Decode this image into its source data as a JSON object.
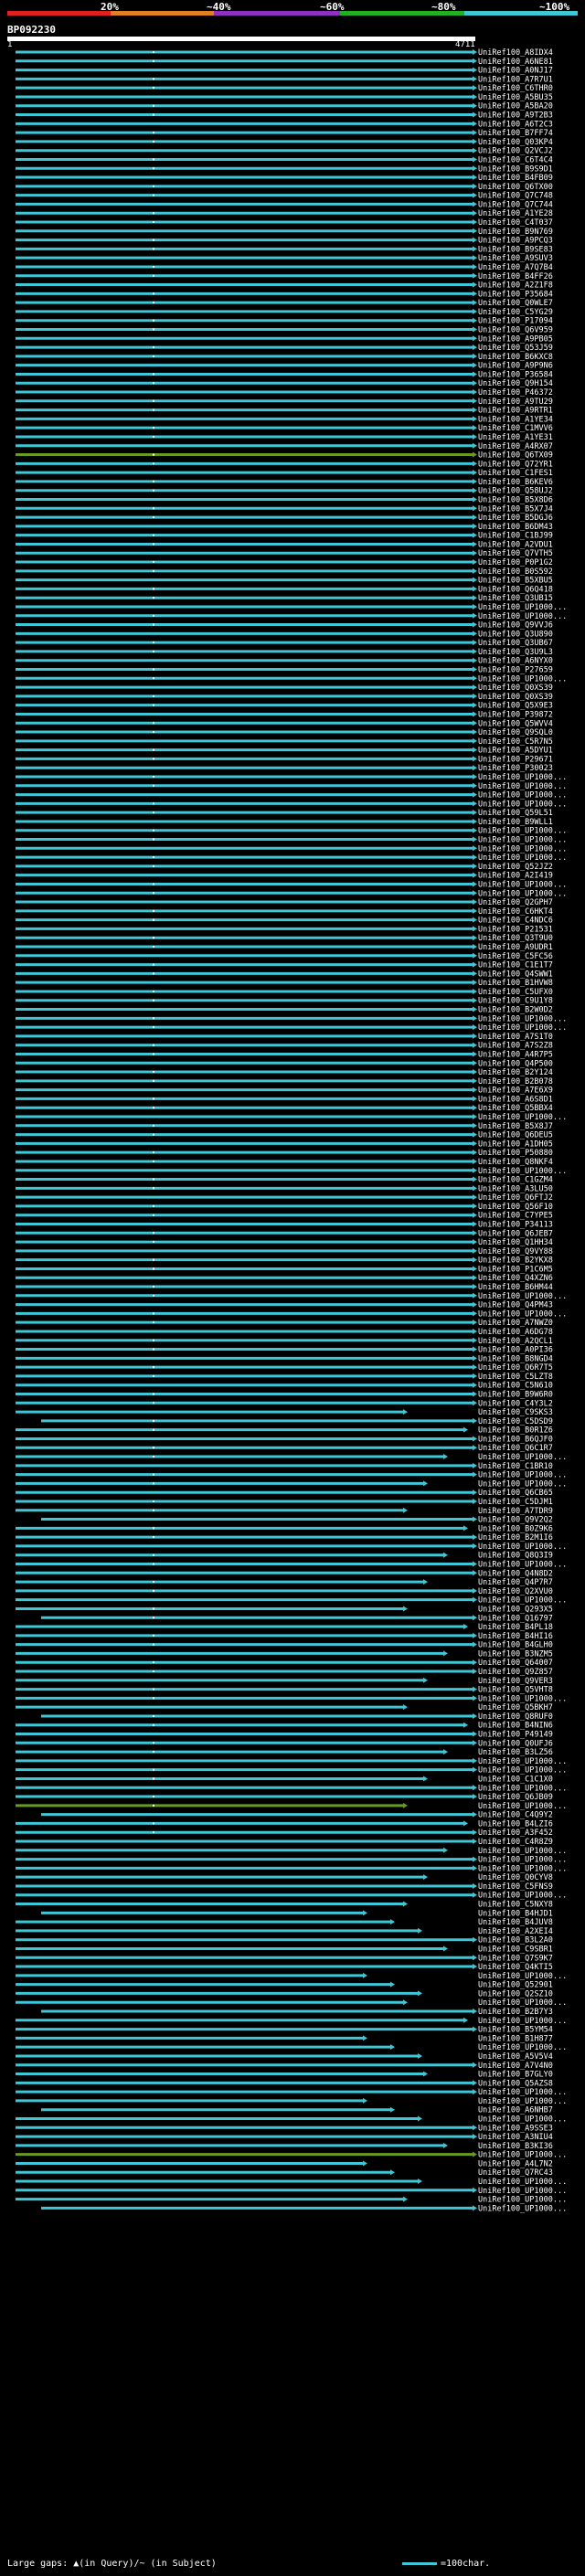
{
  "header": {
    "query_name": "BP092230",
    "query_start": "1",
    "query_end": "4711",
    "scale_labels": [
      "20%",
      "~40%",
      "~60%",
      "~80%",
      "~100%"
    ],
    "scale_colors": [
      "#e02020",
      "#e08020",
      "#9030c0",
      "#20b020",
      "#3ec7d6"
    ]
  },
  "footer": {
    "large_gaps": "Large gaps: ▲(in Query)/~ (in Subject)",
    "scale_text": "=100char."
  },
  "colors": {
    "hit": "#3ec7d6",
    "hit_low": "#6a9a20",
    "gap": "#ffffff"
  },
  "hits": [
    "UniRef100_A8IDX4",
    "UniRef100_A6NE81",
    "UniRef100_A0NJ17",
    "UniRef100_A7R7U1",
    "UniRef100_C6THR0",
    "UniRef100_A5BU35",
    "UniRef100_A5BA20",
    "UniRef100_A9T2B3",
    "UniRef100_A6T2C3",
    "UniRef100_B7FF74",
    "UniRef100_Q03KP4",
    "UniRef100_Q2VCJ2",
    "UniRef100_C6T4C4",
    "UniRef100_B9S9D1",
    "UniRef100_B4FB09",
    "UniRef100_Q6TX00",
    "UniRef100_Q7C748",
    "UniRef100_Q7C744",
    "UniRef100_A1YE28",
    "UniRef100_C4T037",
    "UniRef100_B9N769",
    "UniRef100_A9PCQ3",
    "UniRef100_B9SE83",
    "UniRef100_A9SUV3",
    "UniRef100_A7Q7B4",
    "UniRef100_B4FF26",
    "UniRef100_A2Z1F8",
    "UniRef100_P35684",
    "UniRef100_Q0WLE7",
    "UniRef100_C5YG29",
    "UniRef100_P17094",
    "UniRef100_Q6V959",
    "UniRef100_A9PB05",
    "UniRef100_Q53J59",
    "UniRef100_B6KXC8",
    "UniRef100_A9P9N6",
    "UniRef100_P36584",
    "UniRef100_Q9H154",
    "UniRef100_P46372",
    "UniRef100_A9TU29",
    "UniRef100_A9RTR1",
    "UniRef100_A1YE34",
    "UniRef100_C1MVV6",
    "UniRef100_A1YE31",
    "UniRef100_A4RX07",
    "UniRef100_Q6TX09",
    "UniRef100_Q72YR1",
    "UniRef100_C1FES1",
    "UniRef100_B6KEV6",
    "UniRef100_Q58UJ2",
    "UniRef100_B5X8D6",
    "UniRef100_B5X7J4",
    "UniRef100_B5DGJ6",
    "UniRef100_B6DM43",
    "UniRef100_C1BJ99",
    "UniRef100_A2VDU1",
    "UniRef100_Q7VTH5",
    "UniRef100_P0P1G2",
    "UniRef100_B0S592",
    "UniRef100_B5XBU5",
    "UniRef100_Q6Q418",
    "UniRef100_Q3UB15",
    "UniRef100_UP1000...",
    "UniRef100_UP1000...",
    "UniRef100_Q9VVJ6",
    "UniRef100_Q3U890",
    "UniRef100_Q3UB67",
    "UniRef100_Q3U9L3",
    "UniRef100_A6NYX0",
    "UniRef100_P27659",
    "UniRef100_UP1000...",
    "UniRef100_Q0XS39",
    "UniRef100_Q0XS39",
    "UniRef100_Q5X9E3",
    "UniRef100_P39872",
    "UniRef100_Q5WVV4",
    "UniRef100_Q9SQL0",
    "UniRef100_C5R7N5",
    "UniRef100_A5DYU1",
    "UniRef100_P29671",
    "UniRef100_P30023",
    "UniRef100_UP1000...",
    "UniRef100_UP1000...",
    "UniRef100_UP1000...",
    "UniRef100_UP1000...",
    "UniRef100_Q59L51",
    "UniRef100_B9WLL1",
    "UniRef100_UP1000...",
    "UniRef100_UP1000...",
    "UniRef100_UP1000...",
    "UniRef100_UP1000...",
    "UniRef100_Q52JZ2",
    "UniRef100_A2I419",
    "UniRef100_UP1000...",
    "UniRef100_UP1000...",
    "UniRef100_Q2GPH7",
    "UniRef100_C6HKT4",
    "UniRef100_C4NDC6",
    "UniRef100_P21531",
    "UniRef100_Q3T9U0",
    "UniRef100_A9UDR1",
    "UniRef100_C5FC56",
    "UniRef100_C1E1T7",
    "UniRef100_Q4SWW1",
    "UniRef100_B1HVW8",
    "UniRef100_C5UFX0",
    "UniRef100_C9U1Y8",
    "UniRef100_B2W0D2",
    "UniRef100_UP1000...",
    "UniRef100_UP1000...",
    "UniRef100_A7S1T0",
    "UniRef100_A7S2Z8",
    "UniRef100_A4R7P5",
    "UniRef100_Q4P500",
    "UniRef100_B2Y124",
    "UniRef100_B2B078",
    "UniRef100_A7E6X9",
    "UniRef100_A6S8D1",
    "UniRef100_Q5BBX4",
    "UniRef100_UP1000...",
    "UniRef100_B5X8J7",
    "UniRef100_Q6DEU5",
    "UniRef100_A1DH05",
    "UniRef100_P50880",
    "UniRef100_Q8NKF4",
    "UniRef100_UP1000...",
    "UniRef100_C1GZM4",
    "UniRef100_A3LU50",
    "UniRef100_Q6FTJ2",
    "UniRef100_Q56F10",
    "UniRef100_C7YPE5",
    "UniRef100_P34113",
    "UniRef100_Q6JEB7",
    "UniRef100_Q1HH34",
    "UniRef100_Q9VY88",
    "UniRef100_B2YKX8",
    "UniRef100_P1C6M5",
    "UniRef100_Q4XZN6",
    "UniRef100_B6HM44",
    "UniRef100_UP1000...",
    "UniRef100_Q4PM43",
    "UniRef100_UP1000...",
    "UniRef100_A7NWZ0",
    "UniRef100_A6DG78",
    "UniRef100_A2QCL1",
    "UniRef100_A0PI36",
    "UniRef100_B8NGD4",
    "UniRef100_Q6R7T5",
    "UniRef100_C5LZT8",
    "UniRef100_C5N610",
    "UniRef100_B9W6R0",
    "UniRef100_C4Y3L2",
    "UniRef100_C9SKS3",
    "UniRef100_C5DSD9",
    "UniRef100_B0R1Z6",
    "UniRef100_B6QJF0",
    "UniRef100_Q6C1R7",
    "UniRef100_UP1000...",
    "UniRef100_C1BR10",
    "UniRef100_UP1000...",
    "UniRef100_UP1000...",
    "UniRef100_Q6CB65",
    "UniRef100_C5DJM1",
    "UniRef100_A7TDR9",
    "UniRef100_Q9V2Q2",
    "UniRef100_B0Z9K6",
    "UniRef100_B2M1I6",
    "UniRef100_UP1000...",
    "UniRef100_Q8Q3I9",
    "UniRef100_UP1000...",
    "UniRef100_Q4N8D2",
    "UniRef100_Q4P7R7",
    "UniRef100_Q2XVU0",
    "UniRef100_UP1000...",
    "UniRef100_Q293X5",
    "UniRef100_Q16797",
    "UniRef100_B4PL18",
    "UniRef100_B4HI16",
    "UniRef100_B4GLH0",
    "UniRef100_B3NZM5",
    "UniRef100_Q64007",
    "UniRef100_Q9Z857",
    "UniRef100_Q9VER3",
    "UniRef100_Q5VHT8",
    "UniRef100_UP1000...",
    "UniRef100_Q5BKH7",
    "UniRef100_Q8RUF0",
    "UniRef100_B4NIN6",
    "UniRef100_P49149",
    "UniRef100_Q0UFJ6",
    "UniRef100_B3LZ56",
    "UniRef100_UP1000...",
    "UniRef100_UP1000...",
    "UniRef100_C1C1X0",
    "UniRef100_UP1000...",
    "UniRef100_Q6JB09",
    "UniRef100_UP1000...",
    "UniRef100_C4Q9Y2",
    "UniRef100_B4LZI6",
    "UniRef100_A3F452",
    "UniRef100_C4R8Z9",
    "UniRef100_UP1000...",
    "UniRef100_UP1000...",
    "UniRef100_UP1000...",
    "UniRef100_Q0CYV8",
    "UniRef100_C5FNS9",
    "UniRef100_UP1000...",
    "UniRef100_C5NXY8",
    "UniRef100_B4HJD1",
    "UniRef100_B4JUV8",
    "UniRef100_A2XEI4",
    "UniRef100_B3L2A0",
    "UniRef100_C9SBR1",
    "UniRef100_Q7S9K7",
    "UniRef100_Q4KTI5",
    "UniRef100_UP1000...",
    "UniRef100_Q52901",
    "UniRef100_Q2SZ10",
    "UniRef100_UP1000...",
    "UniRef100_B2B7Y3",
    "UniRef100_UP1000...",
    "UniRef100_B5YM54",
    "UniRef100_B1H877",
    "UniRef100_UP1000...",
    "UniRef100_A5V5V4",
    "UniRef100_A7V4N0",
    "UniRef100_B7GLY0",
    "UniRef100_Q5AZS8",
    "UniRef100_UP1000...",
    "UniRef100_UP1000...",
    "UniRef100_A6NHB7",
    "UniRef100_UP1000...",
    "UniRef100_A9SSE3",
    "UniRef100_A3NIU4",
    "UniRef100_B3KI36",
    "UniRef100_UP1000...",
    "UniRef100_A4L7N2",
    "UniRef100_Q7RC43",
    "UniRef100_UP1000...",
    "UniRef100_UP1000...",
    "UniRef100_UP1000...",
    "UniRef100_UP1000..."
  ]
}
